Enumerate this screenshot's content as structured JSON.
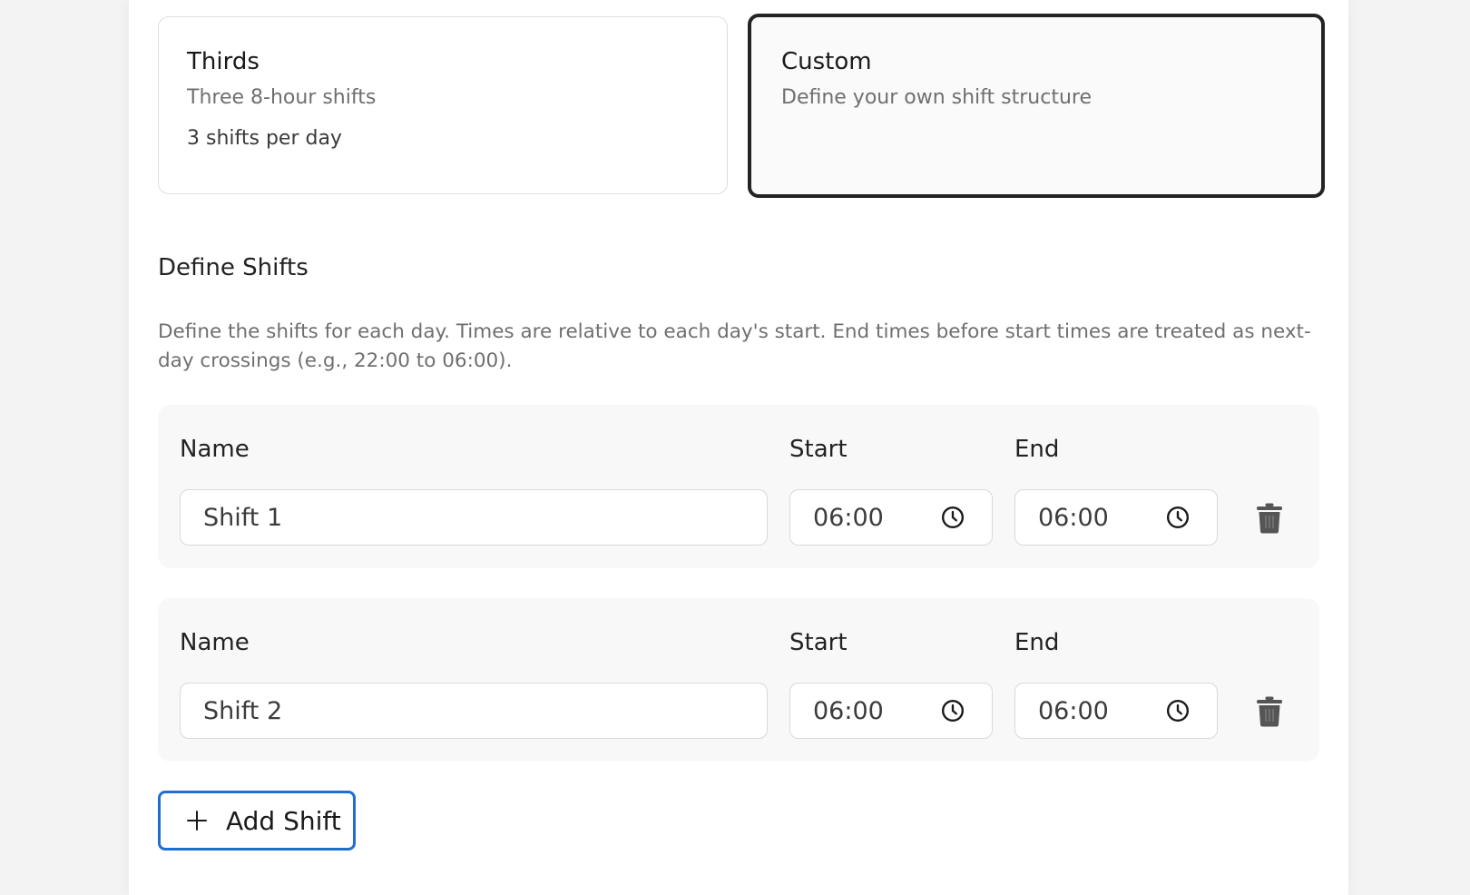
{
  "presets": [
    {
      "title": "Thirds",
      "subtitle": "Three 8-hour shifts",
      "meta": "3 shifts per day"
    },
    {
      "title": "Custom",
      "subtitle": "Define your own shift structure"
    }
  ],
  "define_shifts": {
    "title": "Define Shifts",
    "description": "Define the shifts for each day. Times are relative to each day's start. End times before start times are treated as next-day crossings (e.g., 22:00 to 06:00).",
    "labels": {
      "name": "Name",
      "start": "Start",
      "end": "End"
    },
    "shifts": [
      {
        "name": "Shift 1",
        "start": "06:00",
        "end": "06:00"
      },
      {
        "name": "Shift 2",
        "start": "06:00",
        "end": "06:00"
      }
    ],
    "add_label": "Add Shift"
  },
  "icons": {
    "time": "clock-icon",
    "delete": "trash-icon",
    "add": "plus-icon"
  },
  "colors": {
    "selected_border": "#232323",
    "accent": "#1f6fd1"
  }
}
